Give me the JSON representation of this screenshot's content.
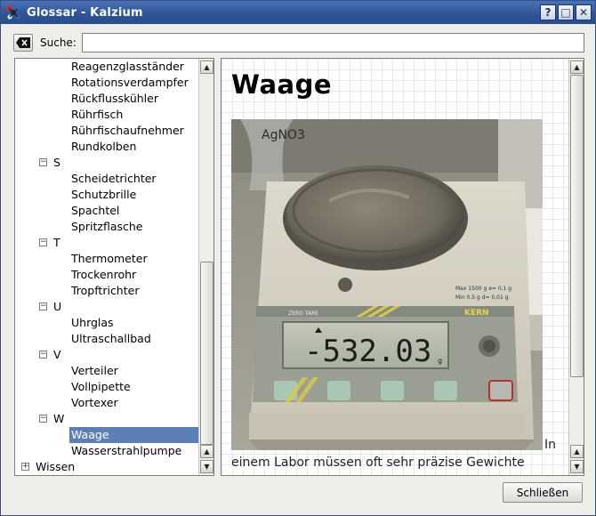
{
  "window": {
    "title": "Glossar - Kalzium",
    "buttons": [
      "?",
      "□",
      "✕"
    ]
  },
  "search": {
    "label": "Suche:",
    "value": "",
    "placeholder": ""
  },
  "tree": {
    "rows": [
      {
        "label": "Reagenzglasständer",
        "kind": "item"
      },
      {
        "label": "Rotationsverdampfer",
        "kind": "item"
      },
      {
        "label": "Rückflusskühler",
        "kind": "item"
      },
      {
        "label": "Rührfisch",
        "kind": "item"
      },
      {
        "label": "Rührfischaufnehmer",
        "kind": "item"
      },
      {
        "label": "Rundkolben",
        "kind": "item"
      },
      {
        "label": "S",
        "kind": "cat"
      },
      {
        "label": "Scheidetrichter",
        "kind": "item"
      },
      {
        "label": "Schutzbrille",
        "kind": "item"
      },
      {
        "label": "Spachtel",
        "kind": "item"
      },
      {
        "label": "Spritzflasche",
        "kind": "item"
      },
      {
        "label": "T",
        "kind": "cat"
      },
      {
        "label": "Thermometer",
        "kind": "item"
      },
      {
        "label": "Trockenrohr",
        "kind": "item"
      },
      {
        "label": "Tropftrichter",
        "kind": "item"
      },
      {
        "label": "U",
        "kind": "cat"
      },
      {
        "label": "Uhrglas",
        "kind": "item"
      },
      {
        "label": "Ultraschallbad",
        "kind": "item"
      },
      {
        "label": "V",
        "kind": "cat"
      },
      {
        "label": "Verteiler",
        "kind": "item"
      },
      {
        "label": "Vollpipette",
        "kind": "item"
      },
      {
        "label": "Vortexer",
        "kind": "item"
      },
      {
        "label": "W",
        "kind": "cat"
      },
      {
        "label": "Waage",
        "kind": "item",
        "selected": true
      },
      {
        "label": "Wasserstrahlpumpe",
        "kind": "item"
      },
      {
        "label": "Wissen",
        "kind": "top"
      }
    ]
  },
  "content": {
    "title": "Waage",
    "photo_display": "-532.03",
    "photo_brand": "KERN",
    "photo_unit": "g",
    "photo_flask_label": "AgNO3",
    "inline_text": "In",
    "body_text": "einem Labor müssen oft sehr präzise Gewichte"
  },
  "footer": {
    "close_label": "Schließen"
  }
}
